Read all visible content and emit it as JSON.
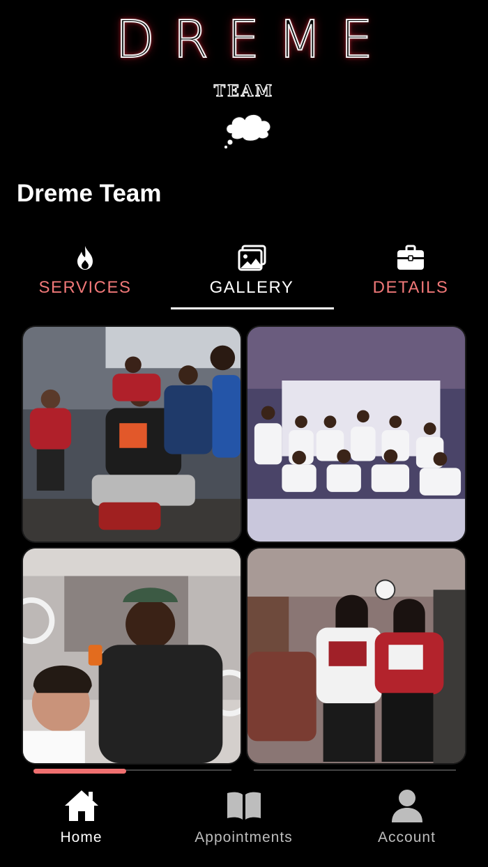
{
  "logo": {
    "wordmark": "DREME",
    "sub_wordmark": "TEAM",
    "neon_color": "#ff3246",
    "icon": "thought-cloud-icon"
  },
  "page": {
    "title": "Dreme Team"
  },
  "tabs": [
    {
      "label": "SERVICES",
      "icon": "flame-icon",
      "active": false,
      "color": "#f07878"
    },
    {
      "label": "GALLERY",
      "icon": "image-icon",
      "active": true,
      "color": "#ffffff"
    },
    {
      "label": "DETAILS",
      "icon": "briefcase-icon",
      "active": false,
      "color": "#f07878"
    }
  ],
  "gallery": {
    "photos": [
      {
        "name": "group-jerseys-photo"
      },
      {
        "name": "event-backdrop-photo"
      },
      {
        "name": "barber-cutting-photo"
      },
      {
        "name": "two-women-jerseys-photo"
      }
    ]
  },
  "scroll_progress": 0.22,
  "accent_color": "#f07070",
  "bottom_nav": [
    {
      "label": "Home",
      "icon": "home-icon",
      "active": true
    },
    {
      "label": "Appointments",
      "icon": "book-icon",
      "active": false
    },
    {
      "label": "Account",
      "icon": "user-icon",
      "active": false
    }
  ]
}
